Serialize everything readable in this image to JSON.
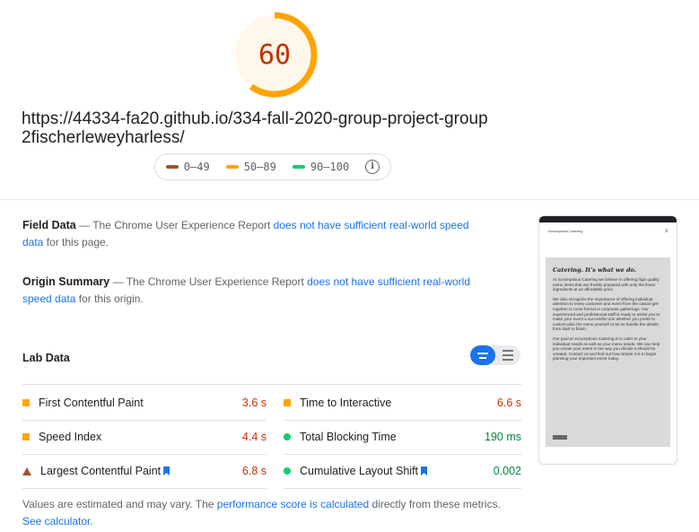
{
  "score": {
    "value": "60",
    "fraction": 0.6,
    "color": "#ffa400"
  },
  "url": "https://44334-fa20.github.io/334-fall-2020-group-project-group2fischerleweyharless/",
  "legend": [
    {
      "label": "0–49",
      "color": "#a0532d"
    },
    {
      "label": "50–89",
      "color": "#ffa400"
    },
    {
      "label": "90–100",
      "color": "#0cce6b"
    }
  ],
  "field_data": {
    "title": "Field Data",
    "dash": " — The Chrome User Experience Report ",
    "link": "does not have sufficient real-world speed data",
    "tail": " for this page."
  },
  "origin_summary": {
    "title": "Origin Summary",
    "dash": " — The Chrome User Experience Report ",
    "link": "does not have sufficient real-world speed data",
    "tail": " for this origin."
  },
  "lab_data": {
    "title": "Lab Data",
    "metrics": [
      {
        "name": "First Contentful Paint",
        "value": "3.6 s",
        "status": "average",
        "color": "#c33300"
      },
      {
        "name": "Time to Interactive",
        "value": "6.6 s",
        "status": "average",
        "color": "#c33300"
      },
      {
        "name": "Speed Index",
        "value": "4.4 s",
        "status": "average",
        "color": "#c33300"
      },
      {
        "name": "Total Blocking Time",
        "value": "190 ms",
        "status": "pass",
        "color": "#018642"
      },
      {
        "name": "Largest Contentful Paint",
        "value": "6.8 s",
        "status": "fail",
        "color": "#c33300"
      },
      {
        "name": "Cumulative Layout Shift",
        "value": "0.002",
        "status": "pass",
        "color": "#018642"
      }
    ]
  },
  "note": {
    "pre": "Values are estimated and may vary. The ",
    "link1": "performance score is calculated",
    "mid": " directly from these metrics. ",
    "link2": "See calculator",
    "end": "."
  },
  "screenshot": {
    "brand": "Scrumptious Catering",
    "menu": "≡",
    "title": "Catering. It's what we do.",
    "paragraphs": [
      "At Scrumptious Catering we believe in offering high quality menu items that are freshly prepared with only the finest ingredients at an affordable price.",
      "We also recognize the importance of offering individual attention to every customer and event from the casual get-together to more formal or corporate gatherings. Our experienced and professional staff is ready to assist you to make your event a successful one whether you prefer to custom-plan the menu yourself or let us handle the details from start to finish.",
      "Our goal at Scrumptious Catering is to cater to your individual needs as well as your menu needs. We can help you create your event in the way you decide it should be created. Contact us and find out how simple it is to begin planning your important event today."
    ]
  }
}
